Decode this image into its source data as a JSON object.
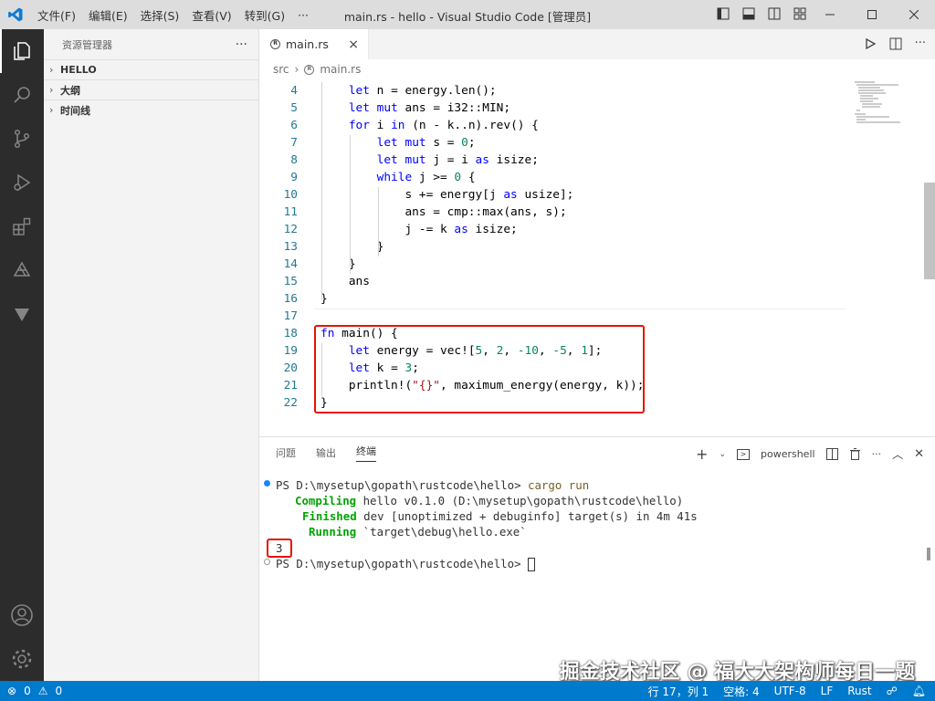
{
  "window": {
    "title": "main.rs - hello - Visual Studio Code [管理员]",
    "menu": [
      "文件(F)",
      "编辑(E)",
      "选择(S)",
      "查看(V)",
      "转到(G)",
      "···"
    ]
  },
  "sidebar": {
    "title": "资源管理器",
    "more": "···",
    "sections": [
      "HELLO",
      "大纲",
      "时间线"
    ]
  },
  "editor": {
    "tab_label": "main.rs",
    "tab_close": "×",
    "breadcrumb_folder": "src",
    "breadcrumb_sep": "›",
    "breadcrumb_file": "main.rs"
  },
  "code_lines": [
    {
      "n": "4",
      "t": "    let n = energy.len();"
    },
    {
      "n": "5",
      "t": "    let mut ans = i32::MIN;"
    },
    {
      "n": "6",
      "t": "    for i in (n - k..n).rev() {"
    },
    {
      "n": "7",
      "t": "        let mut s = 0;"
    },
    {
      "n": "8",
      "t": "        let mut j = i as isize;"
    },
    {
      "n": "9",
      "t": "        while j >= 0 {"
    },
    {
      "n": "10",
      "t": "            s += energy[j as usize];"
    },
    {
      "n": "11",
      "t": "            ans = cmp::max(ans, s);"
    },
    {
      "n": "12",
      "t": "            j -= k as isize;"
    },
    {
      "n": "13",
      "t": "        }"
    },
    {
      "n": "14",
      "t": "    }"
    },
    {
      "n": "15",
      "t": "    ans"
    },
    {
      "n": "16",
      "t": "}"
    },
    {
      "n": "17",
      "t": ""
    },
    {
      "n": "18",
      "t": "fn main() {"
    },
    {
      "n": "19",
      "t": "    let energy = vec![5, 2, -10, -5, 1];"
    },
    {
      "n": "20",
      "t": "    let k = 3;"
    },
    {
      "n": "21",
      "t": "    println!(\"{}\", maximum_energy(energy, k));"
    },
    {
      "n": "22",
      "t": "}"
    }
  ],
  "panel": {
    "tabs": [
      "问题",
      "输出",
      "终端"
    ],
    "active_tab": "终端",
    "shell": "powershell"
  },
  "terminal": {
    "lines": [
      "PS D:\\mysetup\\gopath\\rustcode\\hello> cargo run",
      "Compiling hello v0.1.0 (D:\\mysetup\\gopath\\rustcode\\hello)",
      "Finished dev [unoptimized + debuginfo] target(s) in 4m 41s",
      "Running `target\\debug\\hello.exe`",
      "3",
      "PS D:\\mysetup\\gopath\\rustcode\\hello> "
    ],
    "cmd_prompt": "PS D:\\mysetup\\gopath\\rustcode\\hello> ",
    "cmd": "cargo run",
    "compiling_kw": "Compiling",
    "compiling_rest": " hello v0.1.0 (D:\\mysetup\\gopath\\rustcode\\hello)",
    "finished_kw": "Finished",
    "finished_rest": " dev [unoptimized + debuginfo] target(s) in 4m 41s",
    "running_kw": "Running",
    "running_rest": " `target\\debug\\hello.exe`",
    "output": "3",
    "prompt2": "PS D:\\mysetup\\gopath\\rustcode\\hello> "
  },
  "statusbar": {
    "errors": "0",
    "warnings": "0",
    "position": "行 17，列 1",
    "spaces": "空格: 4",
    "encoding": "UTF-8",
    "eol": "LF",
    "language": "Rust"
  },
  "watermark": "掘金技术社区 @ 福大大架构师每日一题",
  "colors": {
    "accent": "#007acc",
    "highlight_box": "#e51400",
    "activitybar": "#2c2c2c"
  }
}
